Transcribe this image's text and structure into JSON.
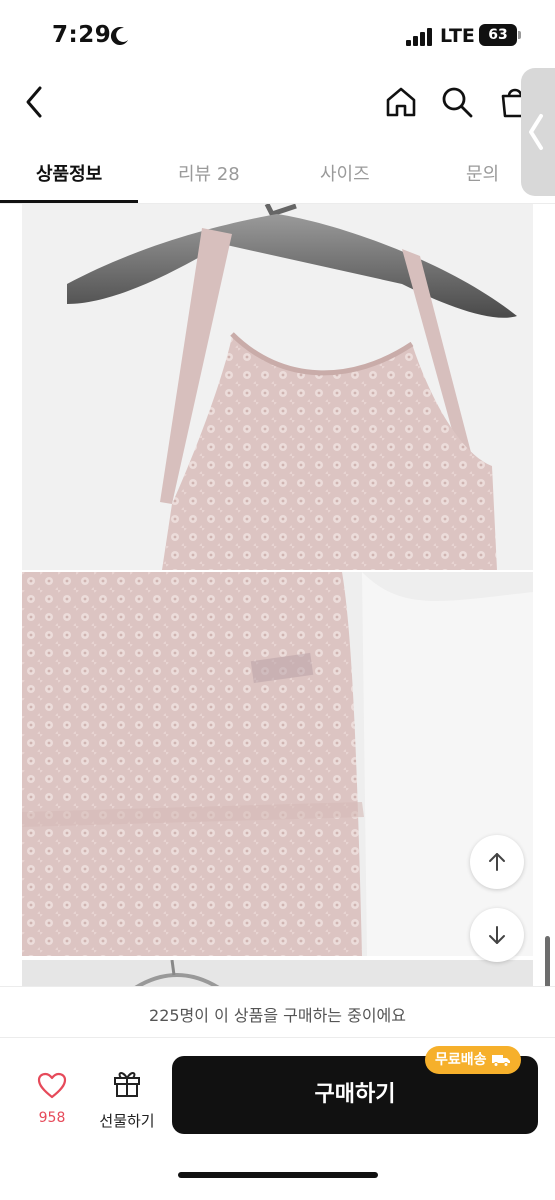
{
  "status_bar": {
    "time": "7:29",
    "network": "LTE",
    "battery": "63"
  },
  "header": {
    "back_icon": "chevron-left-icon",
    "home_icon": "home-icon",
    "search_icon": "search-icon",
    "cart_icon": "shopping-bag-icon"
  },
  "tabs": [
    {
      "label": "상품정보",
      "active": true
    },
    {
      "label": "리뷰 28",
      "active": false
    },
    {
      "label": "사이즈",
      "active": false
    },
    {
      "label": "문의",
      "active": false
    }
  ],
  "product_images": [
    {
      "alt": "pink lace camisole on hanger"
    },
    {
      "alt": "pink lace camisole hem close-up"
    },
    {
      "alt": "camisole on hanger"
    }
  ],
  "float_buttons": {
    "up_icon": "arrow-up-icon",
    "down_icon": "arrow-down-icon"
  },
  "notice": "225명이 이 상품을 구매하는 중이에요",
  "bottom_bar": {
    "like_count": "958",
    "gift_label": "선물하기",
    "buy_label": "구매하기",
    "free_shipping_badge": "무료배송"
  },
  "colors": {
    "accent_like": "#e64a5a",
    "badge": "#f6b02b",
    "buy_button": "#111111"
  }
}
